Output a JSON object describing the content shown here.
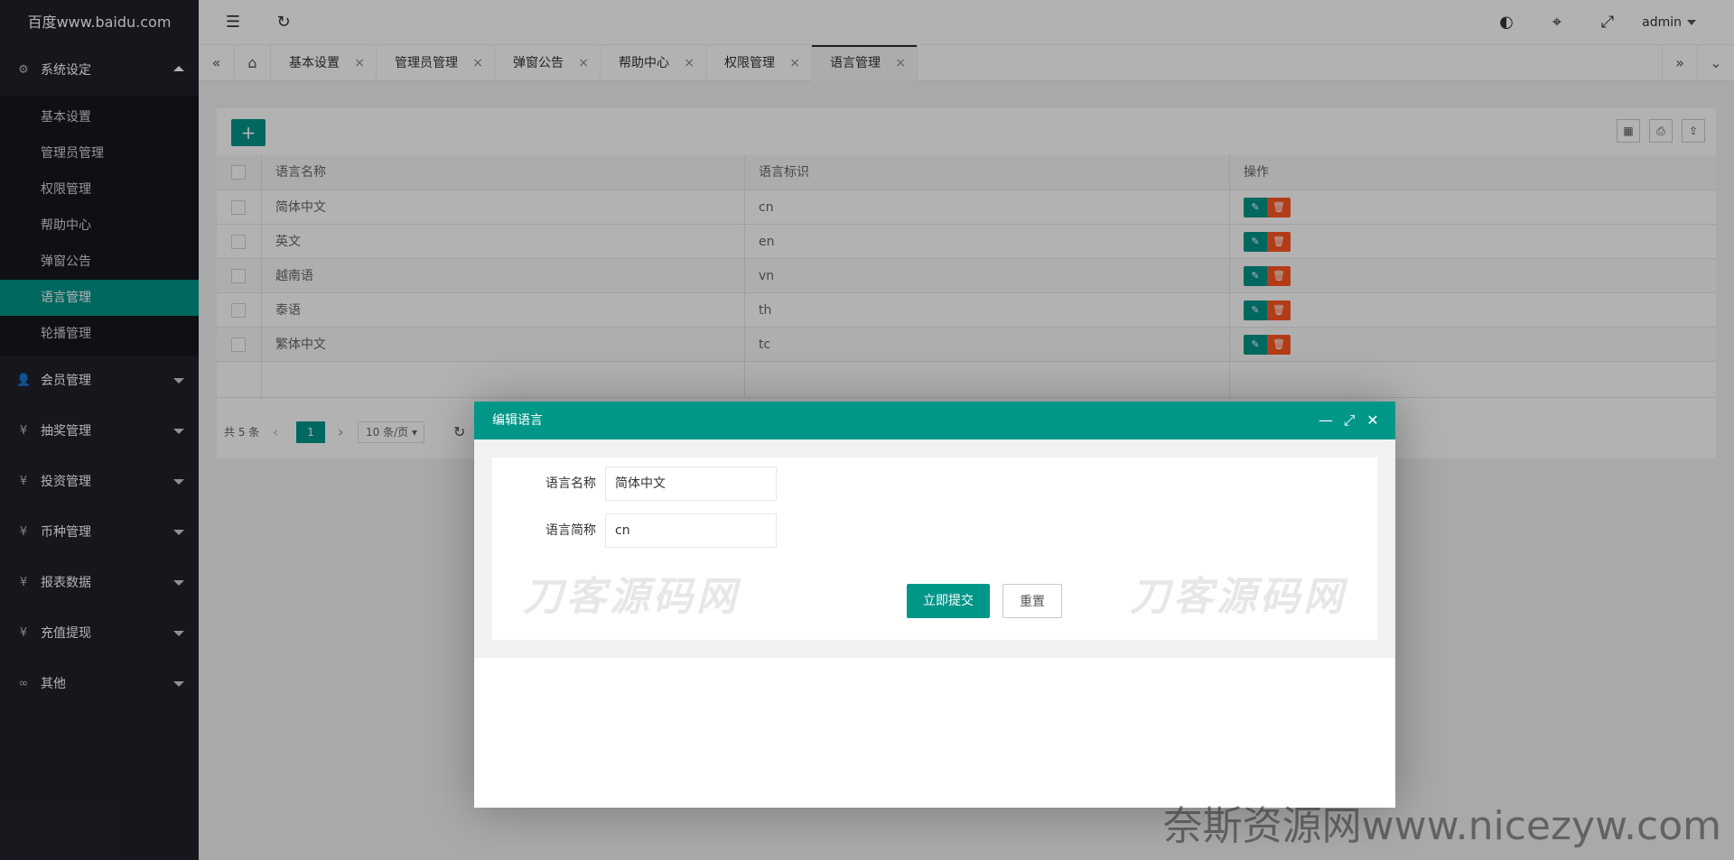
{
  "logo": "百度www.baidu.com",
  "sidebar": {
    "group_system": "系统设定",
    "sub_items": [
      {
        "label": "基本设置"
      },
      {
        "label": "管理员管理"
      },
      {
        "label": "权限管理"
      },
      {
        "label": "帮助中心"
      },
      {
        "label": "弹窗公告"
      },
      {
        "label": "语言管理"
      },
      {
        "label": "轮播管理"
      }
    ],
    "groups": [
      {
        "label": "会员管理"
      },
      {
        "label": "抽奖管理"
      },
      {
        "label": "投资管理"
      },
      {
        "label": "币种管理"
      },
      {
        "label": "报表数据"
      },
      {
        "label": "充值提现"
      },
      {
        "label": "其他"
      }
    ]
  },
  "header": {
    "user": "admin"
  },
  "tabs": [
    {
      "label": "基本设置"
    },
    {
      "label": "管理员管理"
    },
    {
      "label": "弹窗公告"
    },
    {
      "label": "帮助中心"
    },
    {
      "label": "权限管理"
    },
    {
      "label": "语言管理"
    }
  ],
  "table": {
    "headers": [
      "语言名称",
      "语言标识",
      "操作"
    ],
    "rows": [
      {
        "name": "简体中文",
        "code": "cn"
      },
      {
        "name": "英文",
        "code": "en"
      },
      {
        "name": "越南语",
        "code": "vn"
      },
      {
        "name": "泰语",
        "code": "th"
      },
      {
        "name": "繁体中文",
        "code": "tc"
      }
    ]
  },
  "pager": {
    "total": "共 5 条",
    "current": "1",
    "page_size": "10 条/页"
  },
  "modal": {
    "title": "编辑语言",
    "label_name": "语言名称",
    "value_name": "简体中文",
    "label_code": "语言简称",
    "value_code": "cn",
    "submit": "立即提交",
    "reset": "重置"
  },
  "watermarks": {
    "left": "刀客源码网",
    "right": "刀客源码网",
    "bottom": "奈斯资源网www.nicezyw.com"
  },
  "colors": {
    "accent": "#009688",
    "danger": "#ff5722",
    "sidebar": "#20222a"
  }
}
